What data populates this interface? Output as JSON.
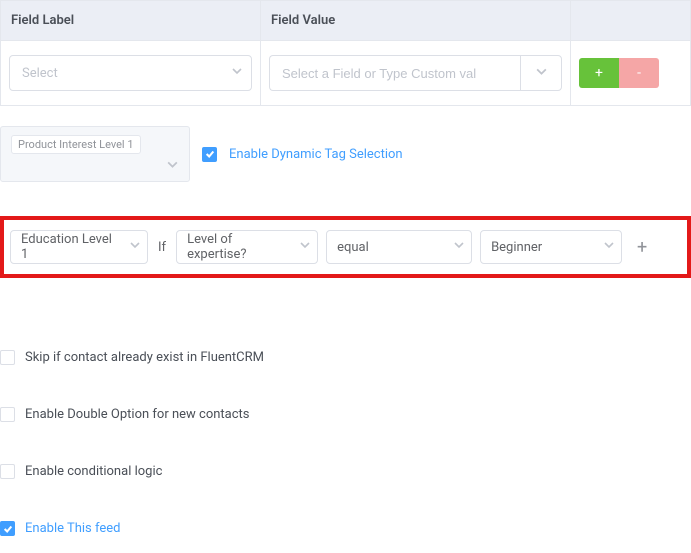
{
  "table": {
    "header_label": "Field Label",
    "header_value": "Field Value",
    "select_placeholder": "Select",
    "value_placeholder": "Select a Field or Type Custom val",
    "add": "+",
    "remove": "-"
  },
  "tag": {
    "chip": "Product Interest Level 1",
    "enable_dynamic": "Enable Dynamic Tag Selection"
  },
  "condition": {
    "tag_select": "Education Level 1",
    "if": "If",
    "field": "Level of expertise?",
    "operator": "equal",
    "value": "Beginner",
    "add": "+"
  },
  "options": {
    "skip": "Skip if contact already exist in FluentCRM",
    "double_optin": "Enable Double Option for new contacts",
    "conditional": "Enable conditional logic",
    "enable_feed": "Enable This feed"
  }
}
